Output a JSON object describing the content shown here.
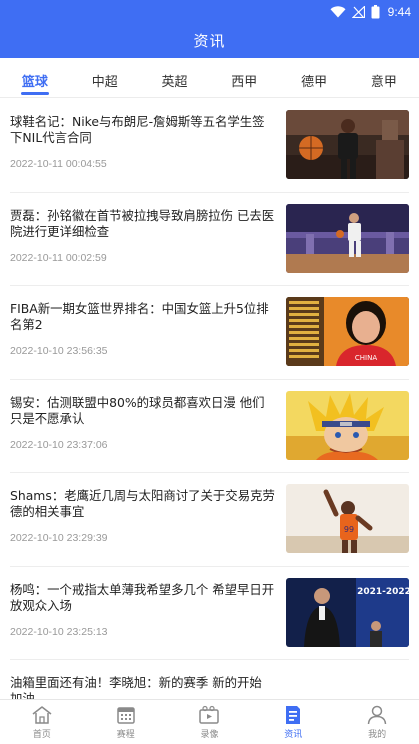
{
  "status_bar": {
    "time": "9:44"
  },
  "header": {
    "title": "资讯"
  },
  "tabs": [
    {
      "label": "篮球",
      "active": true
    },
    {
      "label": "中超",
      "active": false
    },
    {
      "label": "英超",
      "active": false
    },
    {
      "label": "西甲",
      "active": false
    },
    {
      "label": "德甲",
      "active": false
    },
    {
      "label": "意甲",
      "active": false
    }
  ],
  "news": [
    {
      "title": "球鞋名记：Nike与布朗尼-詹姆斯等五名学生签下NIL代言合同",
      "time": "2022-10-11 00:04:55",
      "image_icon": "basketball-player-photo"
    },
    {
      "title": "贾磊：孙铭徽在首节被拉拽导致肩膀拉伤 已去医院进行更详细检查",
      "time": "2022-10-11 00:02:59",
      "image_icon": "basketball-game-photo"
    },
    {
      "title": "FIBA新一期女篮世界排名：中国女篮上升5位排名第2",
      "time": "2022-10-10 23:56:35",
      "image_icon": "china-womens-player-photo"
    },
    {
      "title": "锡安：估测联盟中80%的球员都喜欢日漫 他们只是不愿承认",
      "time": "2022-10-10 23:37:06",
      "image_icon": "anime-character-photo"
    },
    {
      "title": "Shams：老鹰近几周与太阳商讨了关于交易克劳德的相关事宜",
      "time": "2022-10-10 23:29:39",
      "image_icon": "suns-player-photo"
    },
    {
      "title": "杨鸣：一个戒指太单薄我希望多几个 希望早日开放观众入场",
      "time": "2022-10-10 23:25:13",
      "image_icon": "coach-photo"
    },
    {
      "title": "油箱里面还有油！李晓旭：新的赛季 新的开始 加油",
      "time": "",
      "image_icon": ""
    }
  ],
  "bottom_nav": [
    {
      "label": "首页",
      "icon": "home-icon",
      "active": false
    },
    {
      "label": "赛程",
      "icon": "calendar-icon",
      "active": false
    },
    {
      "label": "录像",
      "icon": "video-icon",
      "active": false
    },
    {
      "label": "资讯",
      "icon": "news-icon",
      "active": true
    },
    {
      "label": "我的",
      "icon": "profile-icon",
      "active": false
    }
  ],
  "colors": {
    "accent": "#3f6ef3",
    "text": "#222222",
    "muted": "#999999"
  },
  "thumb_captions": {
    "year_badge": "2021-2022",
    "jersey_number": "99",
    "shirt_text": "CHINA"
  }
}
